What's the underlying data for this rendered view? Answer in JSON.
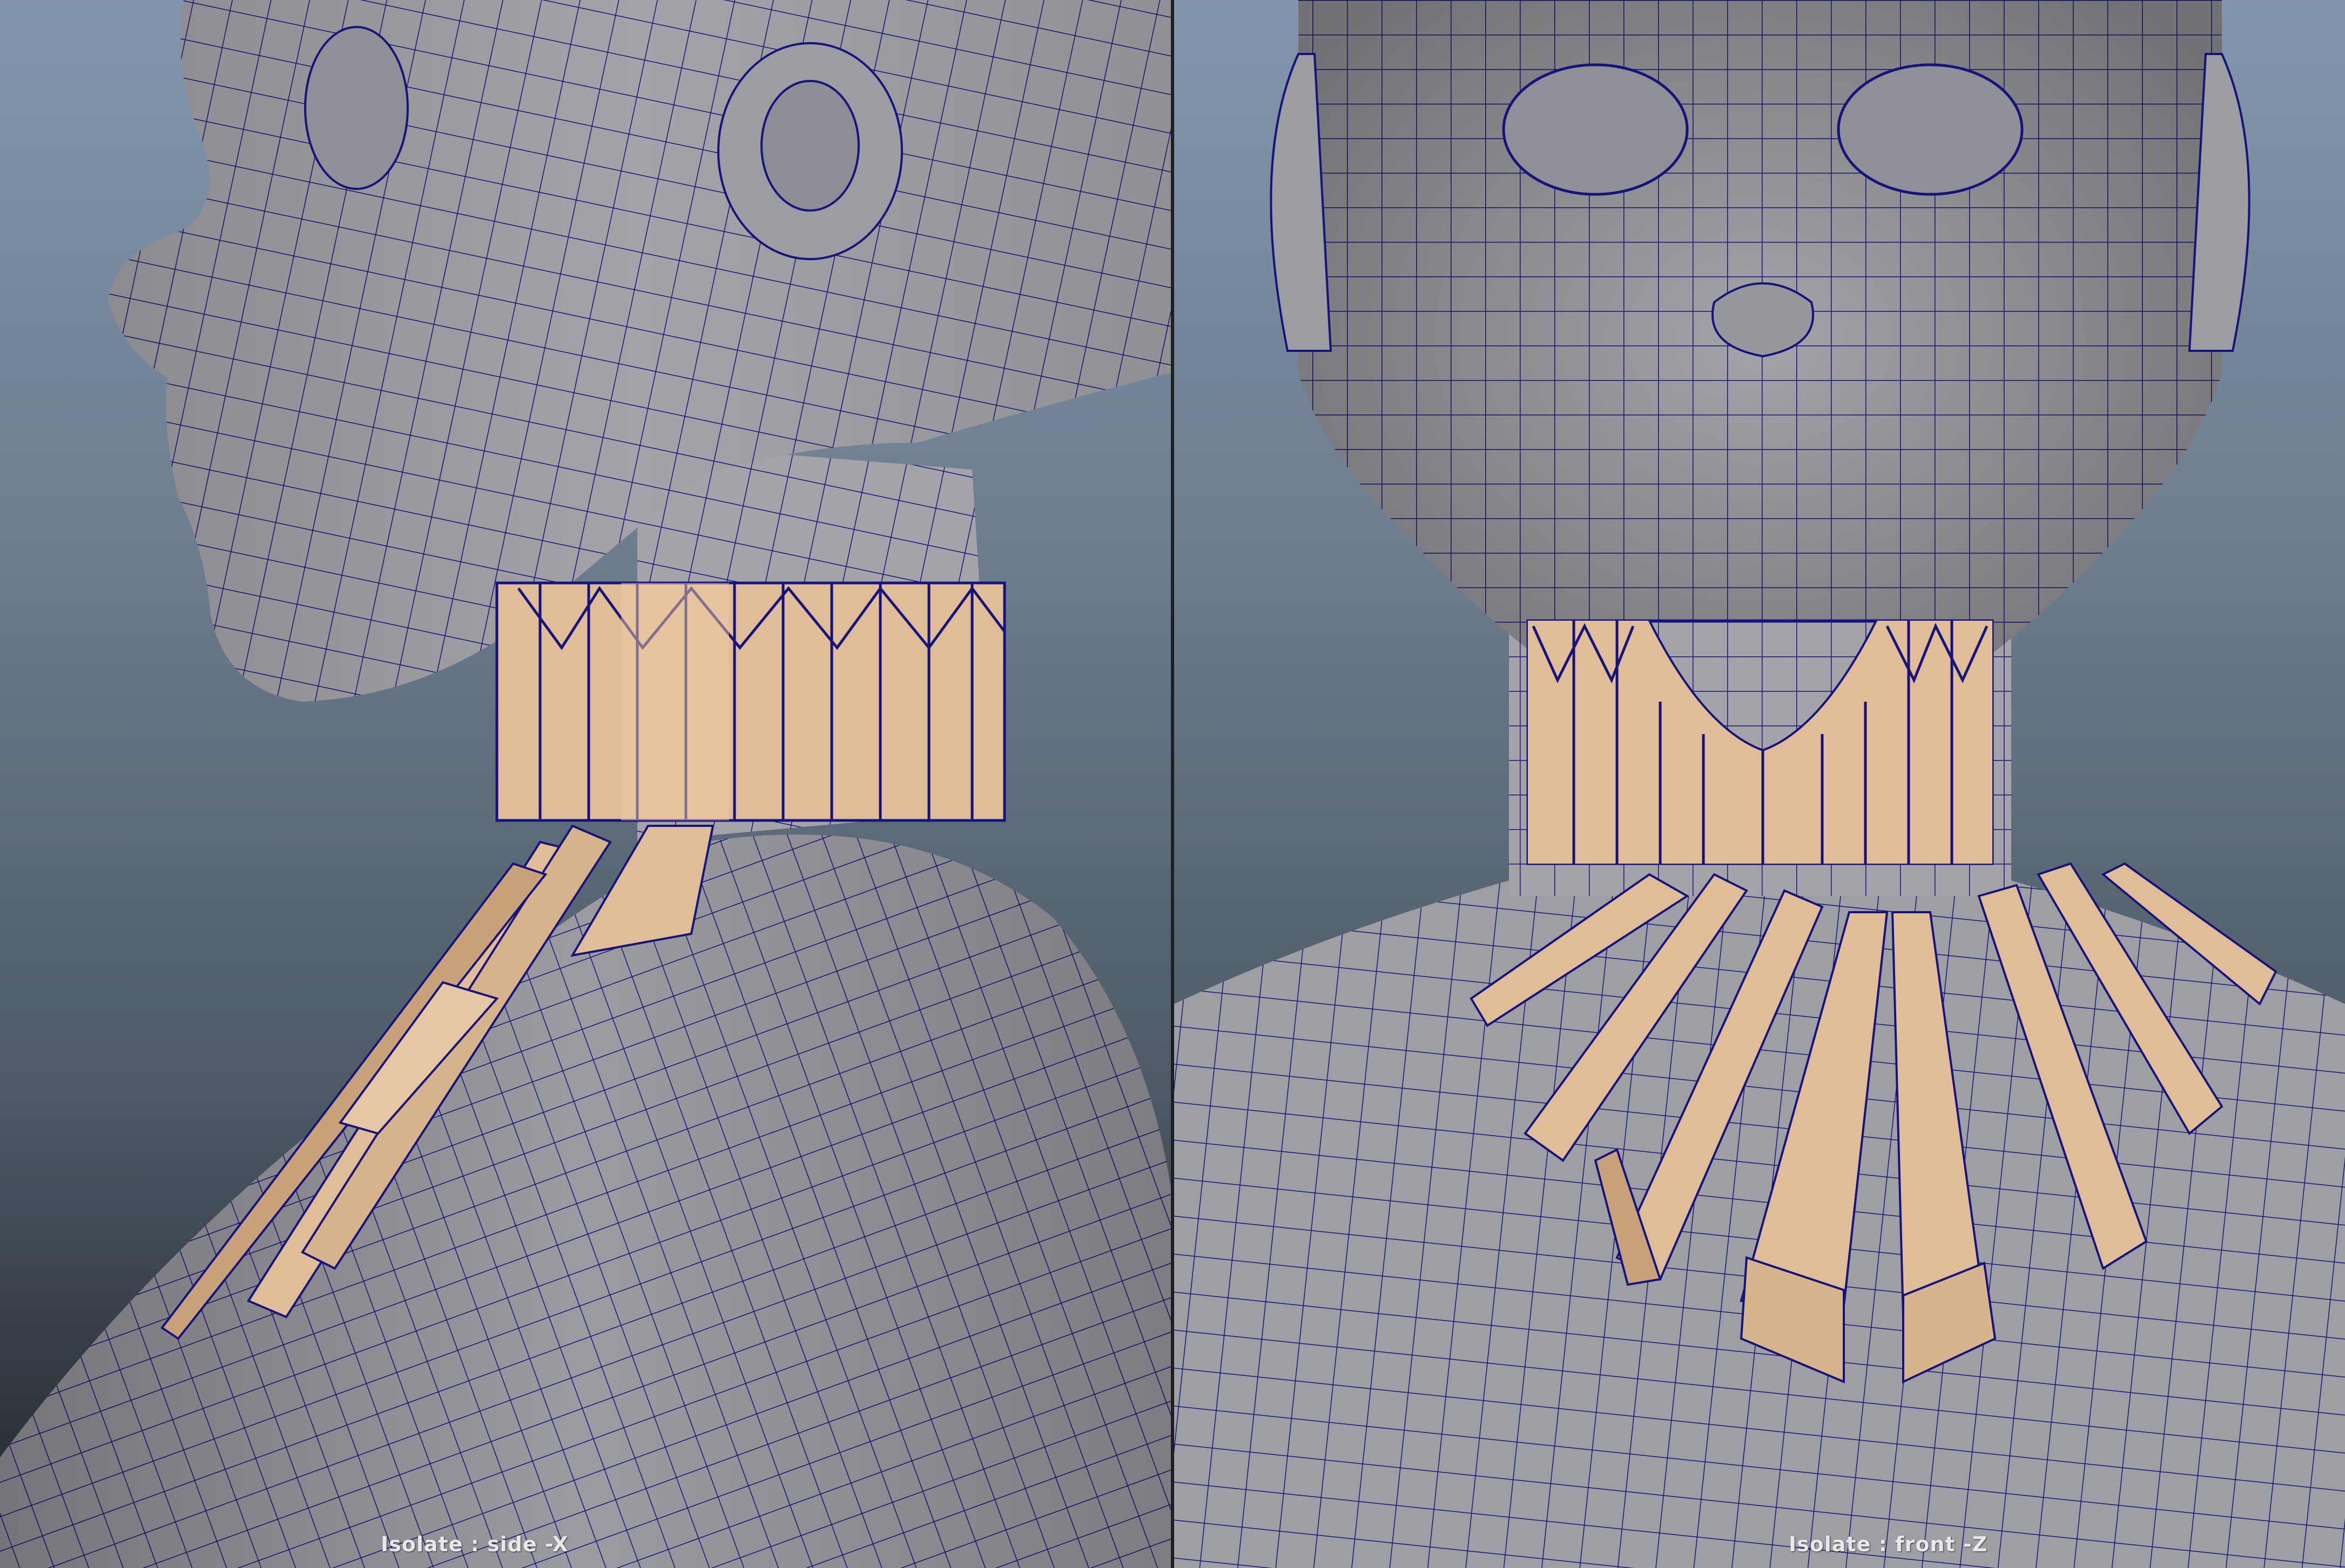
{
  "viewports": [
    {
      "id": "side",
      "label": "Isolate : side -X",
      "mesh_colors": {
        "skin": "#a3a3a9",
        "wire": "#16147a",
        "accessory": "#e0bd98",
        "accessory_dark": "#c9a27c"
      }
    },
    {
      "id": "front",
      "label": "Isolate : front -Z",
      "mesh_colors": {
        "skin": "#a3a3a9",
        "wire": "#16147a",
        "accessory": "#e0bd98",
        "accessory_dark": "#c9a27c"
      }
    }
  ],
  "background_gradient": [
    "#8196ad",
    "#1f2429"
  ]
}
